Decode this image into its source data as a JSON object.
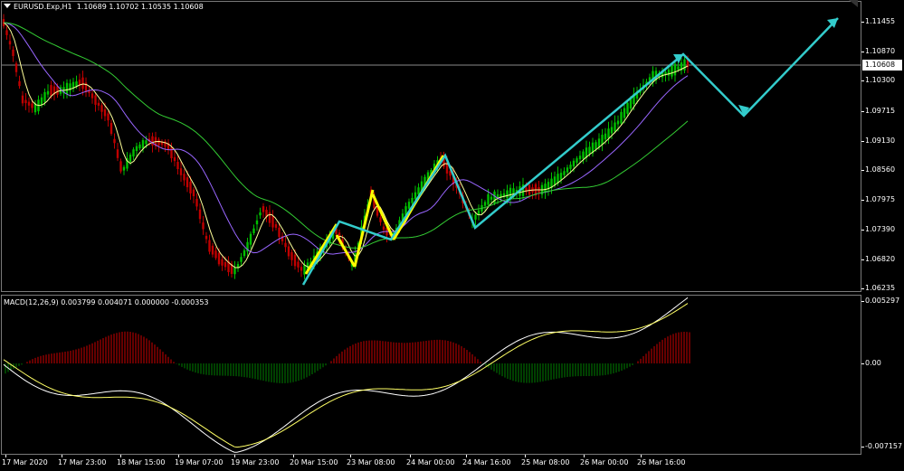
{
  "header": {
    "symbol_timeframe": "EURUSD.Exp,H1",
    "ohlc": "1.10689 1.10702 1.10535 1.10608"
  },
  "macd": {
    "label": "MACD(12,26,9) 0.003799 0.004071 0.000000 -0.000353",
    "axis_labels": [
      "0.005297",
      "0.00",
      "-0.007157"
    ]
  },
  "price_axis": {
    "labels": [
      "1.11455",
      "1.10870",
      "1.10300",
      "1.09715",
      "1.09130",
      "1.08560",
      "1.07975",
      "1.07390",
      "1.06820",
      "1.06235"
    ],
    "current_price_tag": "1.10608"
  },
  "time_axis": {
    "labels": [
      "17 Mar 2020",
      "17 Mar 23:00",
      "18 Mar 15:00",
      "19 Mar 07:00",
      "19 Mar 23:00",
      "20 Mar 15:00",
      "23 Mar 08:00",
      "24 Mar 00:00",
      "24 Mar 16:00",
      "25 Mar 08:00",
      "26 Mar 00:00",
      "26 Mar 16:00"
    ]
  },
  "colors": {
    "background": "#000000",
    "bull_candle": "#00c000",
    "bear_candle": "#c00000",
    "ma_fast": "#ffff99",
    "ma_mid": "#9966ff",
    "ma_slow": "#33cc33",
    "projection_arrow": "#33cccc",
    "wave_arrow": "#ffff00",
    "macd_line": "#ffffff",
    "signal_line": "#ffff66",
    "hist_pos": "#cc0000",
    "hist_neg": "#008000",
    "grid": "#7a7a7a"
  },
  "icons": {
    "chart_dropdown": "triangle-down-icon",
    "window_corner": "chart-corner-icon"
  }
}
